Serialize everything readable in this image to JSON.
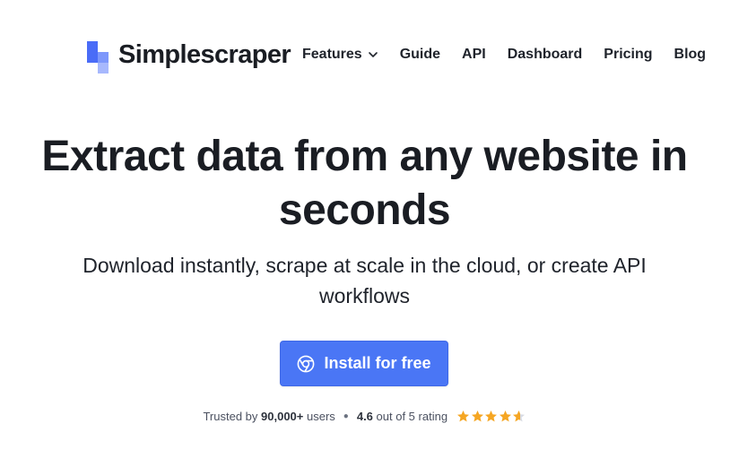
{
  "brand": {
    "name": "Simplescraper",
    "logo_colors": [
      "#4a6cf7",
      "#7d97fb",
      "#a7b8fd"
    ]
  },
  "nav": {
    "features": "Features",
    "guide": "Guide",
    "api": "API",
    "dashboard": "Dashboard",
    "pricing": "Pricing",
    "blog": "Blog"
  },
  "hero": {
    "title_line1": "Extract data from any website in",
    "title_line2": "seconds",
    "subtitle_line1": "Download instantly, scrape at scale in the cloud, or create API",
    "subtitle_line2": "workflows"
  },
  "cta": {
    "label": "Install for free",
    "icon": "chrome-icon",
    "color": "#4a76f5"
  },
  "trust": {
    "prefix": "Trusted by",
    "users_count": "90,000+",
    "users_suffix": "users",
    "rating": "4.6",
    "rating_suffix": "out of 5 rating",
    "stars_value": 4.6,
    "stars_max": 5,
    "star_color": "#f5a623"
  }
}
